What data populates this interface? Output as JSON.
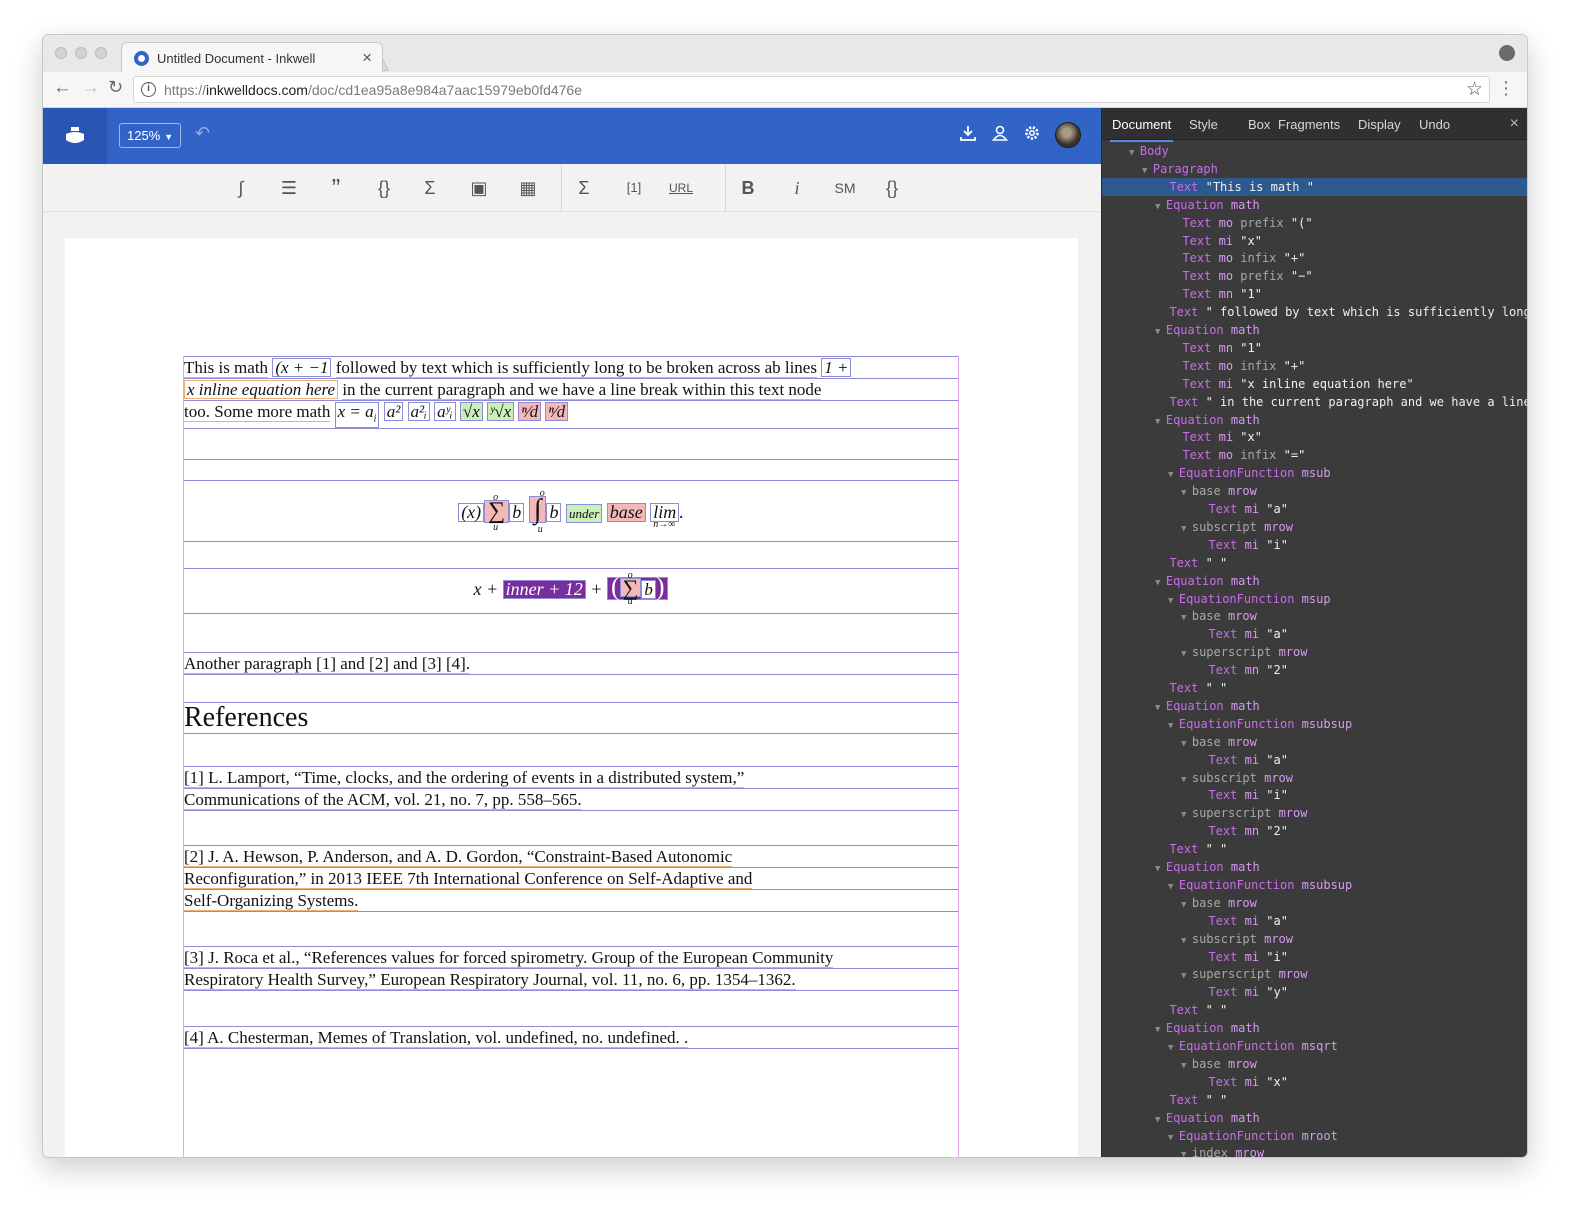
{
  "browser": {
    "tab_title": "Untitled Document - Inkwell",
    "url_scheme": "https://",
    "url_host": "inkwelldocs.com",
    "url_path": "/doc/cd1ea95a8e984a7aac15979eb0fd476e"
  },
  "app": {
    "zoom": "125%",
    "icons": [
      "download-icon",
      "user-icon",
      "gear-icon",
      "avatar"
    ]
  },
  "toolbar": {
    "items": [
      {
        "name": "integral-tool",
        "glyph": "∫"
      },
      {
        "name": "list-tool",
        "glyph": "☰"
      },
      {
        "name": "quote-tool",
        "glyph": "”"
      },
      {
        "name": "braces-tool",
        "glyph": "{}"
      },
      {
        "name": "sigma-tool",
        "glyph": "Σ"
      },
      {
        "name": "image-tool",
        "glyph": "▣"
      },
      {
        "name": "table-tool",
        "glyph": "▦"
      },
      {
        "name": "sigma-tool-2",
        "glyph": "Σ"
      },
      {
        "name": "citation-tool",
        "glyph": "[1]"
      },
      {
        "name": "url-tool",
        "glyph": "URL"
      },
      {
        "name": "bold-tool",
        "glyph": "B"
      },
      {
        "name": "italic-tool",
        "glyph": "i"
      },
      {
        "name": "smallcaps-tool",
        "glyph": "SM"
      },
      {
        "name": "code-tool",
        "glyph": "{}"
      }
    ]
  },
  "document": {
    "p1_l1_a": "This is math",
    "p1_l1_m1": "(x + −1",
    "p1_l1_b": "followed by text which is sufficiently long to be broken across ab lines",
    "p1_l1_m2": "1 +",
    "p1_l2_m": "x inline equation here",
    "p1_l2_b": "in the current paragraph and we have a line break within this text node",
    "p1_l3_a": "too. Some more math",
    "p1_l3_m1": "x = a",
    "p1_l3_sub": "i",
    "p1_l3_m2": "a²",
    "p1_l3_m3": "a²ᵢ",
    "p1_l3_m4": "aʸᵢ",
    "p1_l3_m5": "√x",
    "p1_l3_m6": "ʸ√x",
    "p1_l3_m7": "ⁿ⁄d",
    "p1_l3_m8": "ⁿ⁄d",
    "eq1_a": "(x)",
    "eq1_sum": "∑",
    "eq1_sum_sup": "o",
    "eq1_sum_sub": "u",
    "eq1_b": "b",
    "eq1_int": "∫",
    "eq1_int_sup": "o",
    "eq1_int_sub": "u",
    "eq1_c": "b",
    "eq1_under": "under",
    "eq1_base": "base",
    "eq1_lim": "lim",
    "eq1_lim_sub": "n→∞",
    "eq1_end": ".",
    "eq2_a": "x +",
    "eq2_inner": "inner + 12",
    "eq2_b": "+",
    "eq2_paren_l": "(",
    "eq2_sum": "∑",
    "eq2_sum_sup": "o",
    "eq2_sum_sub": "u",
    "eq2_c": "b",
    "eq2_paren_r": ")",
    "p2": "Another paragraph [1] and [2] and [3] [4].",
    "heading": "References",
    "ref1_l1": "[1] L. Lamport, “Time, clocks, and the ordering of events in a distributed system,”",
    "ref1_l2": "Communications of the ACM, vol. 21, no. 7, pp. 558–565.",
    "ref2_l1": "[2] J. A. Hewson, P. Anderson, and A. D. Gordon, “Constraint-Based Autonomic",
    "ref2_l2": "Reconfiguration,” in 2013 IEEE 7th International Conference on Self-Adaptive and",
    "ref2_l3": "Self-Organizing Systems.",
    "ref3_l1": "[3] J. Roca et al., “References values for forced spirometry. Group of the European Community",
    "ref3_l2": "Respiratory Health Survey,” European Respiratory Journal, vol. 11, no. 6, pp. 1354–1362.",
    "ref4_l1": "[4] A. Chesterman, Memes of Translation, vol. undefined, no. undefined. ."
  },
  "inspector": {
    "tabs": [
      "Document",
      "Style",
      "Box",
      "Fragments",
      "Display",
      "Undo"
    ],
    "active_tab": "Document",
    "rows": [
      {
        "indent": 1,
        "arrow": true,
        "type": "Body",
        "tag": "",
        "mod": "",
        "val": ""
      },
      {
        "indent": 2,
        "arrow": true,
        "type": "Paragraph",
        "tag": "",
        "mod": "",
        "val": ""
      },
      {
        "indent": 3,
        "arrow": false,
        "type": "Text",
        "tag": "",
        "mod": "",
        "val": "\"This is math \"",
        "selected": true
      },
      {
        "indent": 3,
        "arrow": true,
        "type": "Equation",
        "tag": "math",
        "mod": "",
        "val": ""
      },
      {
        "indent": 4,
        "arrow": false,
        "type": "Text",
        "tag": "mo",
        "mod": "prefix",
        "val": "\"(\""
      },
      {
        "indent": 4,
        "arrow": false,
        "type": "Text",
        "tag": "mi",
        "mod": "",
        "val": "\"x\""
      },
      {
        "indent": 4,
        "arrow": false,
        "type": "Text",
        "tag": "mo",
        "mod": "infix",
        "val": "\"+\""
      },
      {
        "indent": 4,
        "arrow": false,
        "type": "Text",
        "tag": "mo",
        "mod": "prefix",
        "val": "\"−\""
      },
      {
        "indent": 4,
        "arrow": false,
        "type": "Text",
        "tag": "mn",
        "mod": "",
        "val": "\"1\""
      },
      {
        "indent": 3,
        "arrow": false,
        "type": "Text",
        "tag": "",
        "mod": "",
        "val": "\" followed by text which is sufficiently long"
      },
      {
        "indent": 3,
        "arrow": true,
        "type": "Equation",
        "tag": "math",
        "mod": "",
        "val": ""
      },
      {
        "indent": 4,
        "arrow": false,
        "type": "Text",
        "tag": "mn",
        "mod": "",
        "val": "\"1\""
      },
      {
        "indent": 4,
        "arrow": false,
        "type": "Text",
        "tag": "mo",
        "mod": "infix",
        "val": "\"+\""
      },
      {
        "indent": 4,
        "arrow": false,
        "type": "Text",
        "tag": "mi",
        "mod": "",
        "val": "\"x inline equation here\""
      },
      {
        "indent": 3,
        "arrow": false,
        "type": "Text",
        "tag": "",
        "mod": "",
        "val": "\" in the current paragraph and we have a line"
      },
      {
        "indent": 3,
        "arrow": true,
        "type": "Equation",
        "tag": "math",
        "mod": "",
        "val": ""
      },
      {
        "indent": 4,
        "arrow": false,
        "type": "Text",
        "tag": "mi",
        "mod": "",
        "val": "\"x\""
      },
      {
        "indent": 4,
        "arrow": false,
        "type": "Text",
        "tag": "mo",
        "mod": "infix",
        "val": "\"=\""
      },
      {
        "indent": 4,
        "arrow": true,
        "type": "EquationFunction",
        "tag": "msub",
        "mod": "",
        "val": ""
      },
      {
        "indent": 5,
        "arrow": true,
        "type": "",
        "tag": "mrow",
        "mod": "base",
        "val": ""
      },
      {
        "indent": 6,
        "arrow": false,
        "type": "Text",
        "tag": "mi",
        "mod": "",
        "val": "\"a\""
      },
      {
        "indent": 5,
        "arrow": true,
        "type": "",
        "tag": "mrow",
        "mod": "subscript",
        "val": ""
      },
      {
        "indent": 6,
        "arrow": false,
        "type": "Text",
        "tag": "mi",
        "mod": "",
        "val": "\"i\""
      },
      {
        "indent": 3,
        "arrow": false,
        "type": "Text",
        "tag": "",
        "mod": "",
        "val": "\" \""
      },
      {
        "indent": 3,
        "arrow": true,
        "type": "Equation",
        "tag": "math",
        "mod": "",
        "val": ""
      },
      {
        "indent": 4,
        "arrow": true,
        "type": "EquationFunction",
        "tag": "msup",
        "mod": "",
        "val": ""
      },
      {
        "indent": 5,
        "arrow": true,
        "type": "",
        "tag": "mrow",
        "mod": "base",
        "val": ""
      },
      {
        "indent": 6,
        "arrow": false,
        "type": "Text",
        "tag": "mi",
        "mod": "",
        "val": "\"a\""
      },
      {
        "indent": 5,
        "arrow": true,
        "type": "",
        "tag": "mrow",
        "mod": "superscript",
        "val": ""
      },
      {
        "indent": 6,
        "arrow": false,
        "type": "Text",
        "tag": "mn",
        "mod": "",
        "val": "\"2\""
      },
      {
        "indent": 3,
        "arrow": false,
        "type": "Text",
        "tag": "",
        "mod": "",
        "val": "\" \""
      },
      {
        "indent": 3,
        "arrow": true,
        "type": "Equation",
        "tag": "math",
        "mod": "",
        "val": ""
      },
      {
        "indent": 4,
        "arrow": true,
        "type": "EquationFunction",
        "tag": "msubsup",
        "mod": "",
        "val": ""
      },
      {
        "indent": 5,
        "arrow": true,
        "type": "",
        "tag": "mrow",
        "mod": "base",
        "val": ""
      },
      {
        "indent": 6,
        "arrow": false,
        "type": "Text",
        "tag": "mi",
        "mod": "",
        "val": "\"a\""
      },
      {
        "indent": 5,
        "arrow": true,
        "type": "",
        "tag": "mrow",
        "mod": "subscript",
        "val": ""
      },
      {
        "indent": 6,
        "arrow": false,
        "type": "Text",
        "tag": "mi",
        "mod": "",
        "val": "\"i\""
      },
      {
        "indent": 5,
        "arrow": true,
        "type": "",
        "tag": "mrow",
        "mod": "superscript",
        "val": ""
      },
      {
        "indent": 6,
        "arrow": false,
        "type": "Text",
        "tag": "mn",
        "mod": "",
        "val": "\"2\""
      },
      {
        "indent": 3,
        "arrow": false,
        "type": "Text",
        "tag": "",
        "mod": "",
        "val": "\" \""
      },
      {
        "indent": 3,
        "arrow": true,
        "type": "Equation",
        "tag": "math",
        "mod": "",
        "val": ""
      },
      {
        "indent": 4,
        "arrow": true,
        "type": "EquationFunction",
        "tag": "msubsup",
        "mod": "",
        "val": ""
      },
      {
        "indent": 5,
        "arrow": true,
        "type": "",
        "tag": "mrow",
        "mod": "base",
        "val": ""
      },
      {
        "indent": 6,
        "arrow": false,
        "type": "Text",
        "tag": "mi",
        "mod": "",
        "val": "\"a\""
      },
      {
        "indent": 5,
        "arrow": true,
        "type": "",
        "tag": "mrow",
        "mod": "subscript",
        "val": ""
      },
      {
        "indent": 6,
        "arrow": false,
        "type": "Text",
        "tag": "mi",
        "mod": "",
        "val": "\"i\""
      },
      {
        "indent": 5,
        "arrow": true,
        "type": "",
        "tag": "mrow",
        "mod": "superscript",
        "val": ""
      },
      {
        "indent": 6,
        "arrow": false,
        "type": "Text",
        "tag": "mi",
        "mod": "",
        "val": "\"y\""
      },
      {
        "indent": 3,
        "arrow": false,
        "type": "Text",
        "tag": "",
        "mod": "",
        "val": "\" \""
      },
      {
        "indent": 3,
        "arrow": true,
        "type": "Equation",
        "tag": "math",
        "mod": "",
        "val": ""
      },
      {
        "indent": 4,
        "arrow": true,
        "type": "EquationFunction",
        "tag": "msqrt",
        "mod": "",
        "val": ""
      },
      {
        "indent": 5,
        "arrow": true,
        "type": "",
        "tag": "mrow",
        "mod": "base",
        "val": ""
      },
      {
        "indent": 6,
        "arrow": false,
        "type": "Text",
        "tag": "mi",
        "mod": "",
        "val": "\"x\""
      },
      {
        "indent": 3,
        "arrow": false,
        "type": "Text",
        "tag": "",
        "mod": "",
        "val": "\" \""
      },
      {
        "indent": 3,
        "arrow": true,
        "type": "Equation",
        "tag": "math",
        "mod": "",
        "val": ""
      },
      {
        "indent": 4,
        "arrow": true,
        "type": "EquationFunction",
        "tag": "mroot",
        "mod": "",
        "val": ""
      },
      {
        "indent": 5,
        "arrow": true,
        "type": "",
        "tag": "mrow",
        "mod": "index",
        "val": ""
      }
    ]
  },
  "colors": {
    "app_blue": "#3264c8",
    "inspector_bg": "#3b3b3b",
    "line_box": "#8c8cd8",
    "word_box": "#f0b070",
    "type_purple": "#c86ee8"
  }
}
